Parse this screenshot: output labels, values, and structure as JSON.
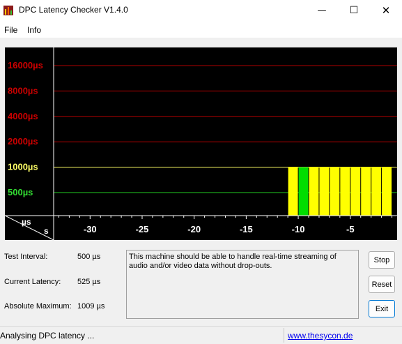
{
  "window": {
    "title": "DPC Latency Checker V1.4.0",
    "minimize_glyph": "—",
    "maximize_glyph": "☐",
    "close_glyph": "✕"
  },
  "menu": {
    "items": [
      "File",
      "Info"
    ]
  },
  "chart_data": {
    "type": "bar",
    "background": "#000000",
    "y_labels": [
      {
        "label": "16000µs",
        "value": 16000,
        "color": "#cc0000",
        "line_color": "#b00000"
      },
      {
        "label": "8000µs",
        "value": 8000,
        "color": "#cc0000",
        "line_color": "#b00000"
      },
      {
        "label": "4000µs",
        "value": 4000,
        "color": "#cc0000",
        "line_color": "#b00000"
      },
      {
        "label": "2000µs",
        "value": 2000,
        "color": "#cc0000",
        "line_color": "#b00000"
      },
      {
        "label": "1000µs",
        "value": 1000,
        "color": "#ffff66",
        "line_color": "#ffff66"
      },
      {
        "label": "500µs",
        "value": 500,
        "color": "#33dd33",
        "line_color": "#22cc22"
      }
    ],
    "x_ticks": [
      -30,
      -25,
      -20,
      -15,
      -10,
      -5
    ],
    "xlim": [
      -33.5,
      -0.5
    ],
    "corner_unit_y": "µs",
    "corner_unit_x": "s",
    "bars": [
      {
        "x": -10.5,
        "value": 1009,
        "color": "#ffff00"
      },
      {
        "x": -9.5,
        "value": 1000,
        "color": "#00dd00"
      },
      {
        "x": -8.5,
        "value": 1009,
        "color": "#ffff00"
      },
      {
        "x": -7.5,
        "value": 1009,
        "color": "#ffff00"
      },
      {
        "x": -6.5,
        "value": 1009,
        "color": "#ffff00"
      },
      {
        "x": -5.5,
        "value": 1009,
        "color": "#ffff00"
      },
      {
        "x": -4.5,
        "value": 1009,
        "color": "#ffff00"
      },
      {
        "x": -3.5,
        "value": 1009,
        "color": "#ffff00"
      },
      {
        "x": -2.5,
        "value": 1009,
        "color": "#ffff00"
      },
      {
        "x": -1.5,
        "value": 1009,
        "color": "#ffff00"
      }
    ]
  },
  "info": {
    "test_interval_label": "Test Interval:",
    "test_interval_value": "500 µs",
    "current_latency_label": "Current Latency:",
    "current_latency_value": "525 µs",
    "absolute_max_label": "Absolute Maximum:",
    "absolute_max_value": "1009 µs"
  },
  "message": "This machine should be able to handle real-time streaming of audio and/or video data without drop-outs.",
  "buttons": {
    "stop": "Stop",
    "reset": "Reset",
    "exit": "Exit"
  },
  "status": {
    "text": "Analysing DPC latency ...",
    "link": "www.thesycon.de"
  }
}
